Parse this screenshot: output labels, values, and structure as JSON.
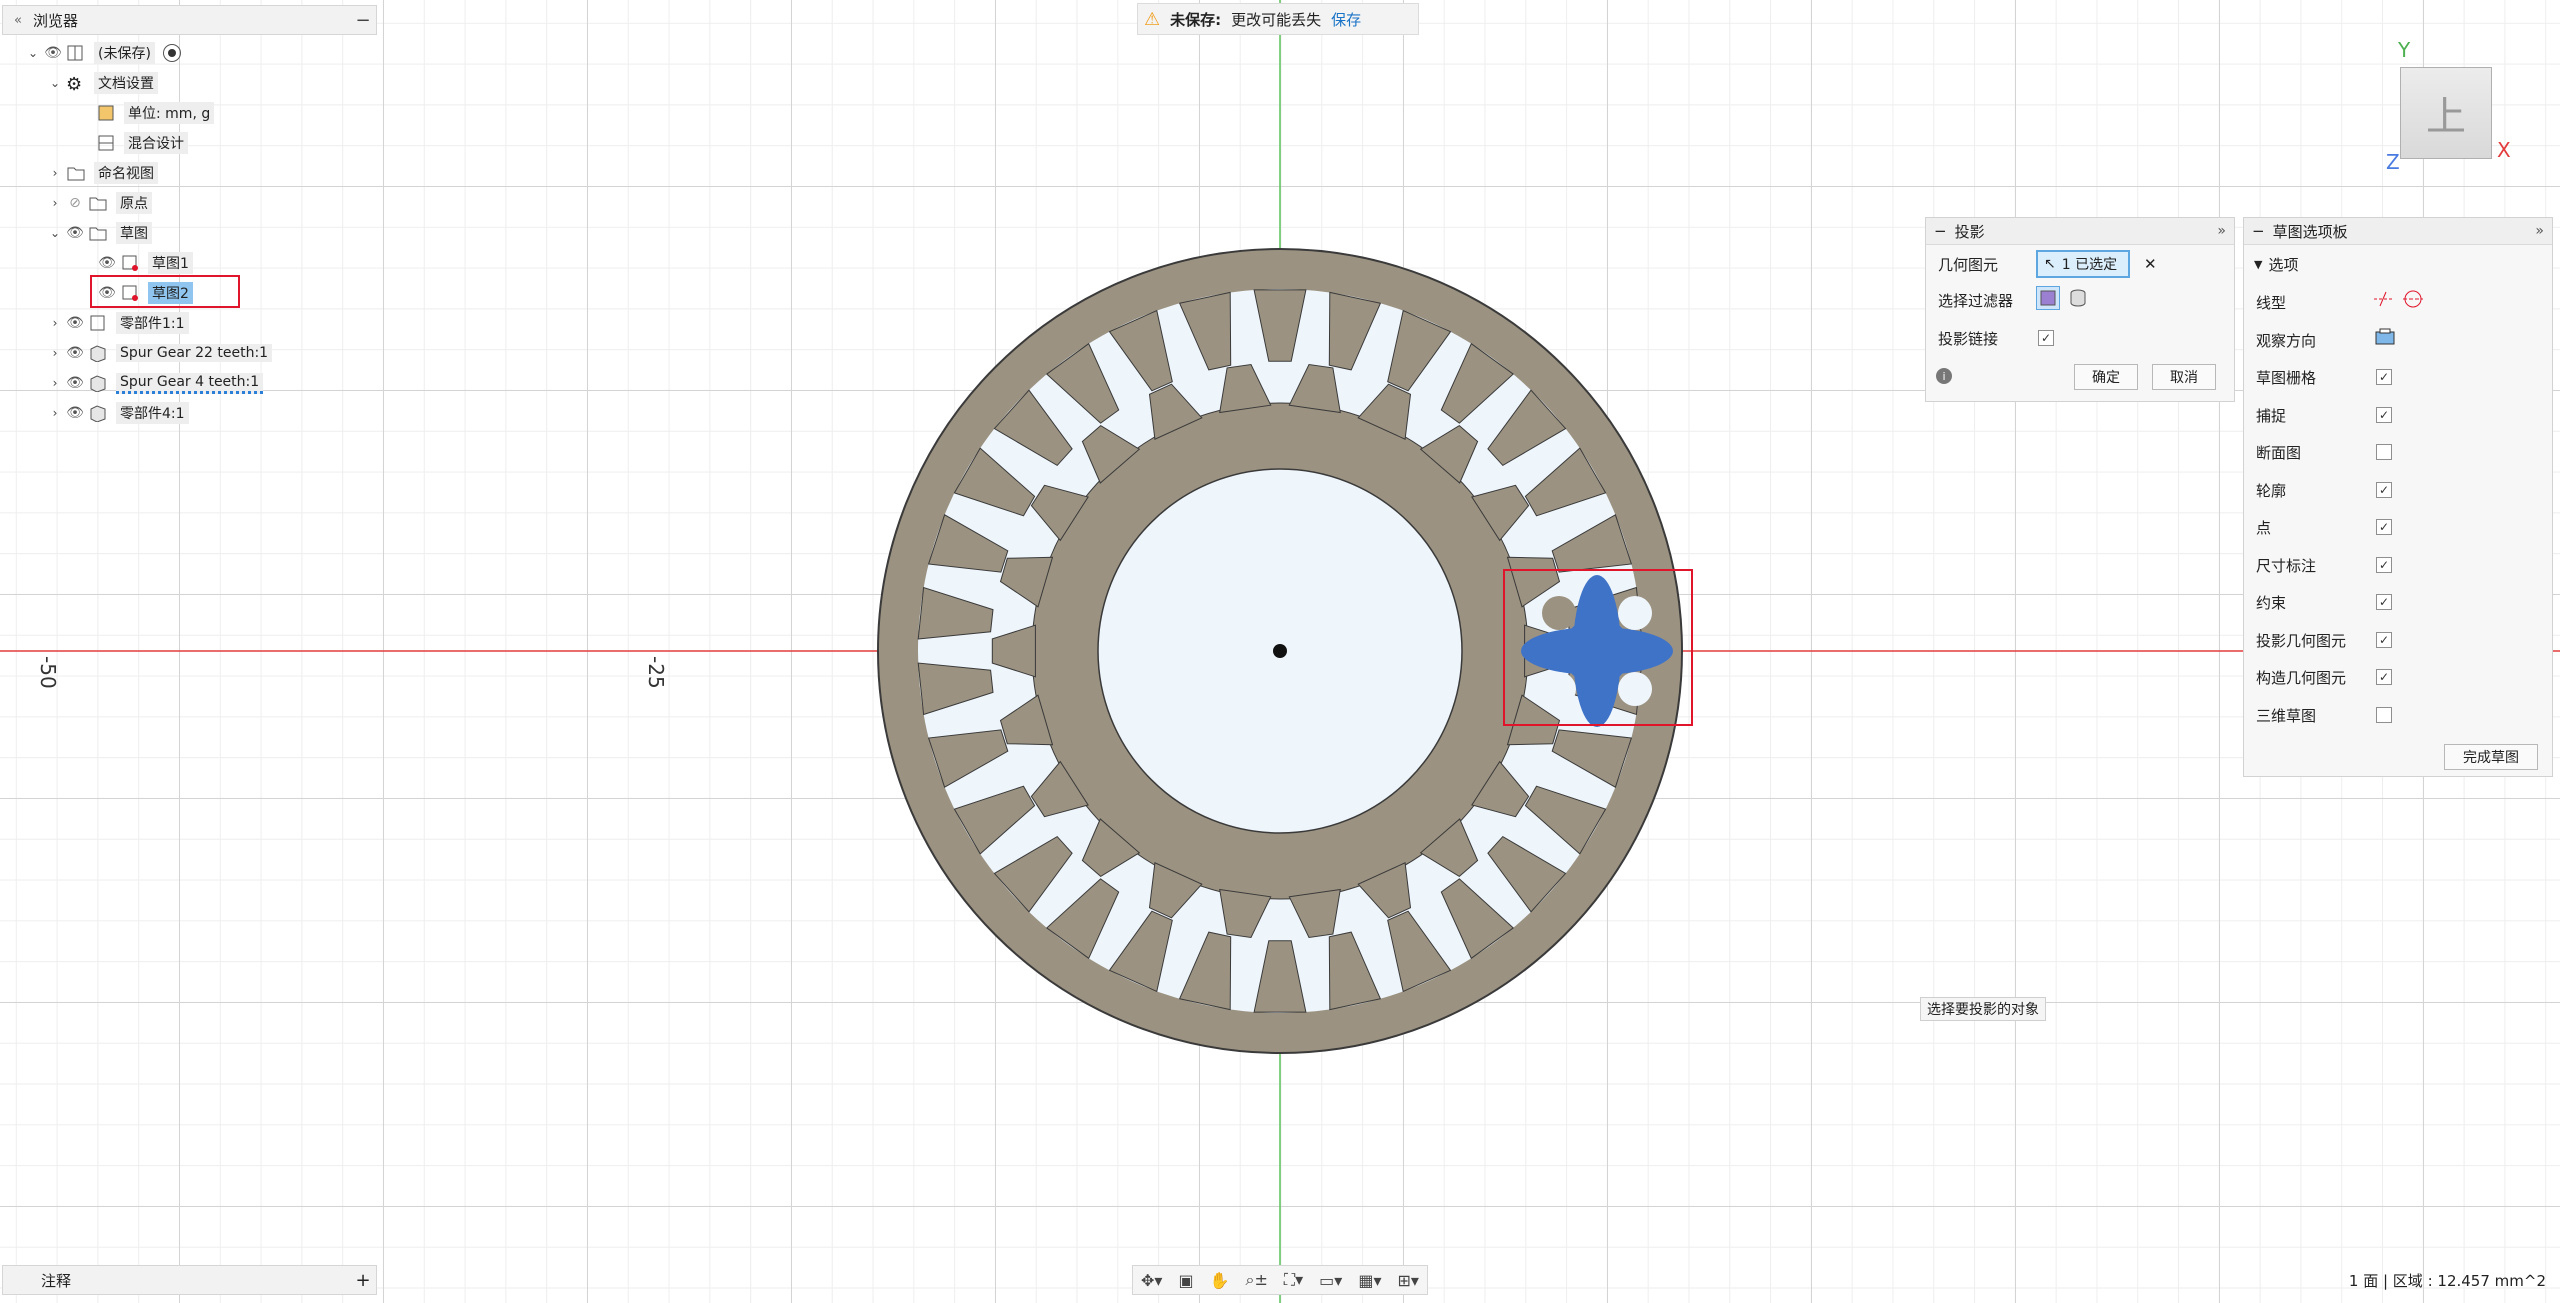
{
  "browser": {
    "title": "浏览器",
    "items": [
      {
        "label": "(未保存)"
      },
      {
        "label": "文档设置"
      },
      {
        "label": "单位: mm, g"
      },
      {
        "label": "混合设计"
      },
      {
        "label": "命名视图"
      },
      {
        "label": "原点"
      },
      {
        "label": "草图"
      },
      {
        "label": "草图1"
      },
      {
        "label": "草图2"
      },
      {
        "label": "零部件1:1"
      },
      {
        "label": "Spur Gear 22 teeth:1"
      },
      {
        "label": "Spur Gear 4 teeth:1"
      },
      {
        "label": "零部件4:1"
      }
    ]
  },
  "warning": {
    "title": "未保存:",
    "message": "更改可能丢失",
    "save_label": "保存"
  },
  "projection": {
    "title": "投影",
    "geometry_label": "几何图元",
    "selected_label": "1 已选定",
    "filter_label": "选择过滤器",
    "link_label": "投影链接",
    "ok_label": "确定",
    "cancel_label": "取消"
  },
  "palette": {
    "title": "草图选项板",
    "section": "选项",
    "linetype_label": "线型",
    "look_at_label": "观察方向",
    "options": [
      {
        "label": "草图栅格",
        "checked": true
      },
      {
        "label": "捕捉",
        "checked": true
      },
      {
        "label": "断面图",
        "checked": false
      },
      {
        "label": "轮廓",
        "checked": true
      },
      {
        "label": "点",
        "checked": true
      },
      {
        "label": "尺寸标注",
        "checked": true
      },
      {
        "label": "约束",
        "checked": true
      },
      {
        "label": "投影几何图元",
        "checked": true
      },
      {
        "label": "构造几何图元",
        "checked": true
      },
      {
        "label": "三维草图",
        "checked": false
      }
    ],
    "finish_label": "完成草图"
  },
  "tooltip": "选择要投影的对象",
  "comments_label": "注释",
  "status": "1 面 | 区域 : 12.457 mm^2",
  "axis_ticks": [
    "-50",
    "-25"
  ],
  "viewcube": {
    "face": "上",
    "axis_x": "X",
    "axis_y": "Y",
    "axis_z": "Z"
  },
  "colors": {
    "accent": "#1a73c7",
    "gear": "#9b9281",
    "selection": "#3f73c8",
    "highlight": "#e0142a"
  }
}
